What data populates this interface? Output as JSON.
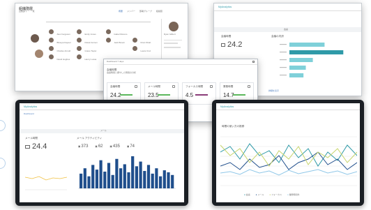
{
  "colors": {
    "accent_blue": "#4f7fbf",
    "teal": "#2f9aa8",
    "green": "#5cb85c",
    "purple": "#8a3b79",
    "navy": "#1f4e8c",
    "light_teal": "#7fd0d9"
  },
  "org_window": {
    "title": "組織階層",
    "subtitle": "直属部下 ・ 一覧",
    "tabs": [
      "概要",
      "メンバー",
      "部署グループ",
      "組織図"
    ],
    "profile_name": "Ryan Gilbert",
    "people": [
      "Alex Ferguson",
      "Bhavya Kapoor",
      "Charles Arnold",
      "David Hughes",
      "Emily Jones",
      "Flavia Vernon",
      "Grace Taylor",
      "Henry Lucas",
      "Isabel Moreno",
      "Jack Brown",
      "Kiran Shah",
      "Laura Cruz"
    ]
  },
  "kpi_window": {
    "header": "Dashboard 7 days",
    "card_title": "会議時間",
    "card_subtitle": "会議時間と費やした時間の分析",
    "kpis": [
      {
        "label": "会議時間",
        "value": "24.2"
      },
      {
        "label": "メール時間",
        "value": "23.5"
      },
      {
        "label": "フォーカス時間",
        "value": "4.5"
      },
      {
        "label": "業務時間",
        "value": "14.7"
      }
    ]
  },
  "right_top_window": {
    "app_name": "MyAnalytics",
    "section_label": "会議",
    "summary_title": "会議時間",
    "summary_value": "24.2",
    "detail_title": "会議の内訳",
    "bars": [
      60,
      92,
      40,
      28,
      24
    ],
    "footer_link": "詳細を表示"
  },
  "left_bottom_window": {
    "app_name": "MyAnalytics",
    "tab": "Dashboard",
    "section_label": "メール",
    "mail_title": "メール時間",
    "mail_value": "24.4",
    "activity_title": "メール アクティビティ",
    "stats": [
      {
        "label": "送信済み",
        "value": "373"
      },
      {
        "label": "受信",
        "value": "62"
      },
      {
        "label": "既読",
        "value": "435"
      },
      {
        "label": "返信",
        "value": "74"
      }
    ],
    "activity_bars": [
      22,
      30,
      18,
      35,
      28,
      42,
      25,
      38,
      20,
      44,
      30,
      36,
      24,
      48,
      33,
      40,
      26,
      35,
      22,
      30,
      18,
      27,
      24,
      20
    ]
  },
  "right_bottom_window": {
    "app_name": "MyAnalytics",
    "chart_title": "時間の使い方の推移",
    "legend": [
      "会議",
      "メール",
      "フォーカス",
      "業務時間外"
    ]
  }
}
